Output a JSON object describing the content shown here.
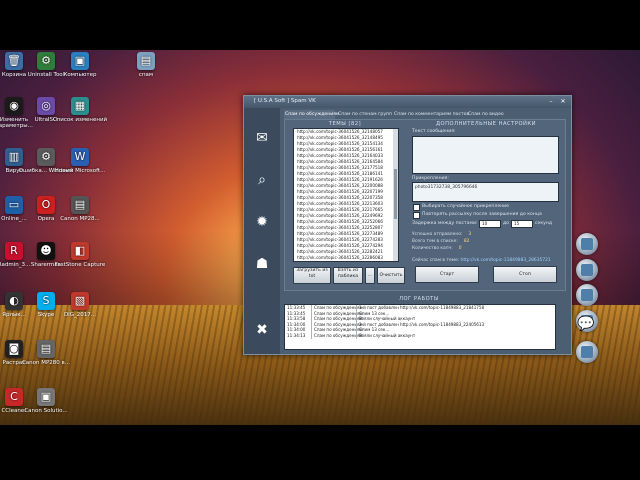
{
  "desktop": {
    "icons": [
      {
        "label": "Корзина",
        "icon": "recycle-bin-icon",
        "color": "#3a6ea5",
        "glyph": "🗑"
      },
      {
        "label": "Uninstall Tool",
        "icon": "uninstall-tool-icon",
        "color": "#2f7d3a",
        "glyph": "⚙"
      },
      {
        "label": "Компьютер",
        "icon": "computer-icon",
        "color": "#2a7fc1",
        "glyph": "▣"
      },
      {
        "label": "спам",
        "icon": "folder-icon",
        "color": "#7da0c0",
        "glyph": "▤"
      },
      {
        "label": "Изменить параметры...",
        "icon": "settings-icon",
        "color": "#1b1b1b",
        "glyph": "◉"
      },
      {
        "label": "UltraISO",
        "icon": "ultraiso-icon",
        "color": "#6b4aa8",
        "glyph": "◎"
      },
      {
        "label": "Список изменений",
        "icon": "document-icon",
        "color": "#2a8f8f",
        "glyph": "▦"
      },
      {
        "label": "Вирус",
        "icon": "shortcut-icon",
        "color": "#2f5f8f",
        "glyph": "▥"
      },
      {
        "label": "Ошибка... Windows",
        "icon": "gear-icon",
        "color": "#5b5b5b",
        "glyph": "⚙"
      },
      {
        "label": "Новый Microsoft...",
        "icon": "word-doc-icon",
        "color": "#2b5fb3",
        "glyph": "W"
      },
      {
        "label": "Online_...",
        "icon": "monitor-icon",
        "color": "#1f5fa8",
        "glyph": "▭"
      },
      {
        "label": "Opera",
        "icon": "opera-icon",
        "color": "#cc1f1f",
        "glyph": "O"
      },
      {
        "label": "Canon MP28...",
        "icon": "printer-icon",
        "color": "#555555",
        "glyph": "▤"
      },
      {
        "label": "Radmin_3...",
        "icon": "radmin-icon",
        "color": "#c8102e",
        "glyph": "R"
      },
      {
        "label": "Sharerman",
        "icon": "sharerman-icon",
        "color": "#111111",
        "glyph": "☻"
      },
      {
        "label": "FastStone Capture",
        "icon": "faststone-icon",
        "color": "#c0392b",
        "glyph": "◧"
      },
      {
        "label": "Ярлык...",
        "icon": "mouse-icon",
        "color": "#333333",
        "glyph": "◐"
      },
      {
        "label": "Skype",
        "icon": "skype-icon",
        "color": "#00aff0",
        "glyph": "S"
      },
      {
        "label": "DIG_2017...",
        "icon": "image-file-icon",
        "color": "#c0392b",
        "glyph": "▧"
      },
      {
        "label": "Растрат",
        "icon": "camera-icon",
        "color": "#222222",
        "glyph": "◙"
      },
      {
        "label": "Canon MP280 в...",
        "icon": "printer-icon",
        "color": "#666666",
        "glyph": "▤"
      },
      {
        "label": "CCleaner",
        "icon": "ccleaner-icon",
        "color": "#c62828",
        "glyph": "C"
      },
      {
        "label": "Canon Solutio...",
        "icon": "canon-icon",
        "color": "#777777",
        "glyph": "▣"
      }
    ],
    "dock_icons": [
      "network-icon",
      "chat-icon",
      "music-icon",
      "screen-icon",
      "globe-icon"
    ]
  },
  "window": {
    "title": "[ U.S.A Soft ] Spam VK",
    "minimize": "–",
    "close": "✕",
    "sidebar_icons": [
      "mail-icon",
      "search-icon",
      "gear-icon",
      "user-icon"
    ],
    "tabs": [
      "Спам по обсуждениям",
      "Спам по стенам групп",
      "Спам по комментариям постов",
      "Спам по видео"
    ],
    "topics_title": "ТЕМЫ [82]",
    "topics": [
      "http://vk.com/topic-36041526_32148057",
      "http://vk.com/topic-36041526_32148495",
      "http://vk.com/topic-36041526_32154134",
      "http://vk.com/topic-36041526_32156161",
      "http://vk.com/topic-36041526_32164033",
      "http://vk.com/topic-36041526_32164584",
      "http://vk.com/topic-36041526_32177518",
      "http://vk.com/topic-36041526_32186141",
      "http://vk.com/topic-36041526_32191626",
      "http://vk.com/topic-36041526_32200088",
      "http://vk.com/topic-36041526_32207199",
      "http://vk.com/topic-36041526_32207358",
      "http://vk.com/topic-36041526_32213603",
      "http://vk.com/topic-36041526_32217665",
      "http://vk.com/topic-36041526_32249692",
      "http://vk.com/topic-36041526_32252066",
      "http://vk.com/topic-36041526_32252807",
      "http://vk.com/topic-36041526_32273489",
      "http://vk.com/topic-36041526_32274283",
      "http://vk.com/topic-36041526_32274294",
      "http://vk.com/topic-36041526_32282421",
      "http://vk.com/topic-36041526_32286083",
      "http://vk.com/topic-36041526_32286783"
    ],
    "btn_load": "Загрузить из txt",
    "btn_take": "Взять из паблика",
    "btn_dots": "...",
    "btn_clear": "Очистить",
    "settings_title": "ДОПОЛНИТЕЛЬНЫЕ НАСТРОЙКИ",
    "message_label": "Текст сообщения:",
    "message_value": "",
    "attach_label": "Прикрепления:",
    "attach_value": "photo31732738_305796646",
    "opt_random_attach": "Выбирать случайное прикрепление",
    "opt_repeat": "Повторять рассылку после завершения до конца",
    "delay_label": "Задержка между постами:",
    "delay_from": "10",
    "delay_to_label": "до",
    "delay_to": "15",
    "delay_unit": "секунд",
    "stats": [
      {
        "label": "Успешно отправлено:",
        "value": "3"
      },
      {
        "label": "Всего тем в списке:",
        "value": "82"
      },
      {
        "label": "Количество капч:",
        "value": "0"
      }
    ],
    "current_topic_label": "Сейчас спам в теме:",
    "current_topic_value": "http://vk.com/topic-11849883_28635721",
    "btn_start": "Старт",
    "btn_stop": "Стоп",
    "log_title": "ЛОГ РАБОТЫ",
    "log": [
      {
        "time": "11:33:45",
        "category": "Спам по обсуждениям",
        "msg": "1-й пост добавлен http://vk.com/topic-11849883_21841758"
      },
      {
        "time": "11:33:45",
        "category": "Спам по обсуждениям",
        "msg": "Спим 13 сек..."
      },
      {
        "time": "11:33:58",
        "category": "Спам по обсуждениям",
        "msg": "Взяли случайный аккаунт"
      },
      {
        "time": "11:34:00",
        "category": "Спам по обсуждениям",
        "msg": "2-й пост добавлен http://vk.com/topic-11849883_22405613"
      },
      {
        "time": "11:34:00",
        "category": "Спам по обсуждениям",
        "msg": "Спим 13 сек..."
      },
      {
        "time": "11:34:13",
        "category": "Спам по обсуждениям",
        "msg": "Взяли случайный аккаунт"
      }
    ]
  }
}
